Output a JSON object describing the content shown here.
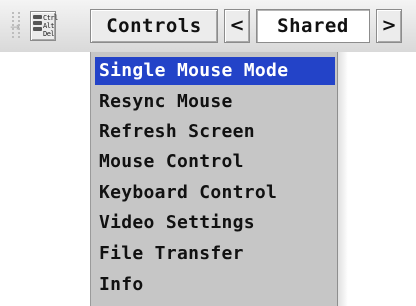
{
  "toolbar": {
    "grip_icon": "grip-arrow-icon",
    "cad_icon": "ctrl-alt-del-icon",
    "cad_text": "Ctrl\nAlt\nDel",
    "controls_label": "Controls",
    "prev_label": "<",
    "shared_value": "Shared",
    "next_label": ">"
  },
  "menu": {
    "items": [
      {
        "label": "Single Mouse Mode",
        "selected": true
      },
      {
        "label": "Resync Mouse"
      },
      {
        "label": "Refresh Screen"
      },
      {
        "label": "Mouse Control"
      },
      {
        "label": "Keyboard Control"
      },
      {
        "label": "Video Settings"
      },
      {
        "label": "File Transfer"
      },
      {
        "label": "Info"
      }
    ],
    "highlight_color": "#2343c8",
    "background_color": "#c6c6c6"
  }
}
